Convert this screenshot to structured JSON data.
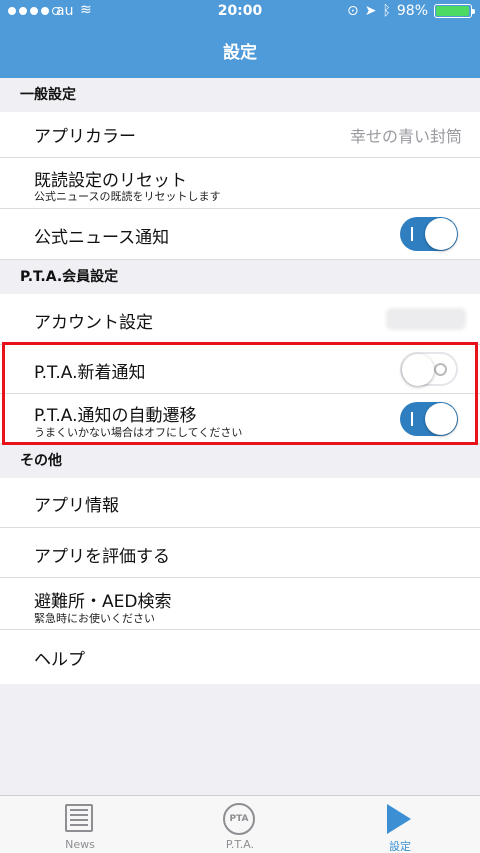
{
  "status_bar": {
    "carrier": "au",
    "time": "20:00",
    "battery": "98%",
    "battery_level": 0.98
  },
  "nav": {
    "title": "設定"
  },
  "sections": {
    "general": {
      "header": "一般設定",
      "app_color": {
        "label": "アプリカラー",
        "value": "幸せの青い封筒"
      },
      "read_reset": {
        "label": "既読設定のリセット",
        "sub": "公式ニュースの既読をリセットします"
      },
      "official_news": {
        "label": "公式ニュース通知",
        "toggle": true
      }
    },
    "pta": {
      "header": "P.T.A.会員設定",
      "account": {
        "label": "アカウント設定"
      },
      "new_notice": {
        "label": "P.T.A.新着通知",
        "toggle": false
      },
      "auto_transition": {
        "label": "P.T.A.通知の自動遷移",
        "sub": "うまくいかない場合はオフにしてください",
        "toggle": true
      }
    },
    "other": {
      "header": "その他",
      "app_info": {
        "label": "アプリ情報"
      },
      "rate_app": {
        "label": "アプリを評価する"
      },
      "shelter": {
        "label": "避難所・AED検索",
        "sub": "緊急時にお使いください"
      },
      "help": {
        "label": "ヘルプ"
      }
    }
  },
  "tabs": [
    {
      "label": "News",
      "icon": "news-icon"
    },
    {
      "label": "P.T.A.",
      "icon": "pta-icon",
      "icon_text": "PTA"
    },
    {
      "label": "設定",
      "icon": "play-icon",
      "active": true
    }
  ],
  "colors": {
    "nav_bg": "#4f9ad8",
    "toggle_on": "#2f7fc0",
    "highlight": "#e8131a",
    "active_tab": "#3b8fd2"
  }
}
